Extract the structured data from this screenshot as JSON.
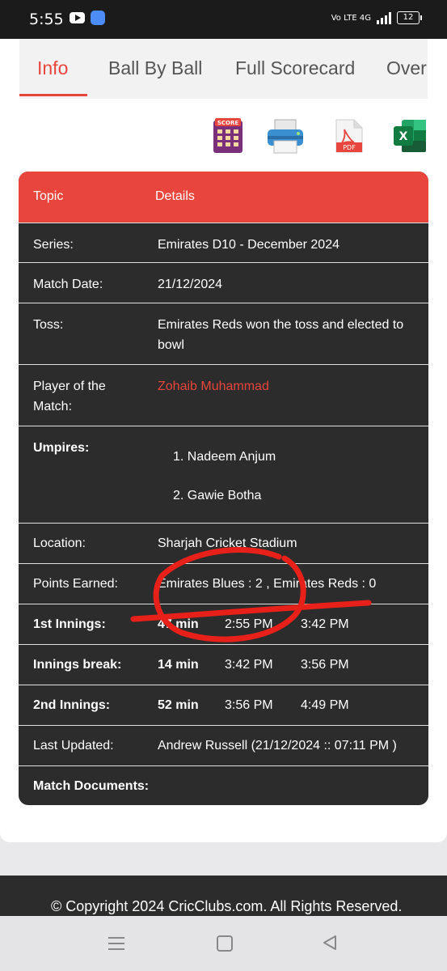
{
  "status_bar": {
    "time": "5:55",
    "network": "Vo LTE 4G",
    "battery": "12"
  },
  "tabs": [
    {
      "label": "Info",
      "active": true
    },
    {
      "label": "Ball By Ball",
      "active": false
    },
    {
      "label": "Full Scorecard",
      "active": false
    },
    {
      "label": "Over by Over",
      "active": false
    }
  ],
  "icons": {
    "scorecard": {
      "name": "scorecard-icon",
      "text": "SCORE"
    },
    "print": {
      "name": "print-icon"
    },
    "pdf": {
      "name": "pdf-icon",
      "text": "PDF"
    },
    "excel": {
      "name": "excel-icon",
      "text": "X"
    }
  },
  "table": {
    "header": {
      "topic": "Topic",
      "details": "Details"
    },
    "series": {
      "label": "Series:",
      "value": "Emirates D10 - December 2024"
    },
    "match_date": {
      "label": "Match Date:",
      "value": "21/12/2024"
    },
    "toss": {
      "label": "Toss:",
      "value": "Emirates Reds won the toss and elected to bowl"
    },
    "player_of_match": {
      "label": "Player of the Match:",
      "value": "Zohaib Muhammad"
    },
    "umpires": {
      "label": "Umpires:",
      "items": [
        "Nadeem Anjum",
        "Gawie Botha"
      ]
    },
    "location": {
      "label": "Location:",
      "value": "Sharjah Cricket Stadium"
    },
    "points": {
      "label": "Points Earned:",
      "value": "Emirates Blues : 2 , Emirates Reds : 0"
    },
    "first_innings": {
      "label": "1st Innings:",
      "duration": "47 min",
      "start": "2:55 PM",
      "end": "3:42 PM"
    },
    "innings_break": {
      "label": "Innings break:",
      "duration": "14 min",
      "start": "3:42 PM",
      "end": "3:56 PM"
    },
    "second_innings": {
      "label": "2nd Innings:",
      "duration": "52 min",
      "start": "3:56 PM",
      "end": "4:49 PM"
    },
    "last_updated": {
      "label": "Last Updated:",
      "value": "Andrew Russell (21/12/2024 :: 07:11 PM )"
    },
    "match_documents": {
      "label": "Match Documents:"
    }
  },
  "footer": {
    "copyright": "© Copyright 2024 CricClubs.com. All Rights Reserved."
  },
  "colors": {
    "accent": "#e8453c",
    "table_bg": "#2c2c2c",
    "annotation": "#e8201a"
  }
}
